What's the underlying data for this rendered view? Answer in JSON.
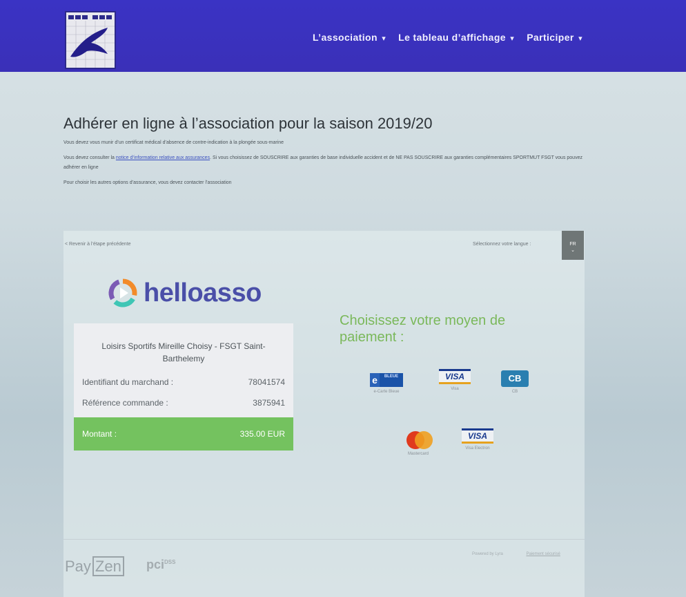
{
  "nav": {
    "items": [
      {
        "label": "L’association"
      },
      {
        "label": "Le tableau d’affichage"
      },
      {
        "label": "Participer"
      }
    ],
    "caret": "▾"
  },
  "page": {
    "title": "Adhérer en ligne à l’association pour la saison 2019/20",
    "info_1": "Vous devez vous munir d’un certificat médical d’absence de contre-indication à la plongée sous-marine",
    "info_2_prefix": "Vous devez consulter la ",
    "info_2_link": "notice d’information relative aux assurances",
    "info_2_suffix": ". Si vous choisissez de SOUSCRIRE aux garanties de base individuelle accident et de NE PAS SOUSCRIRE aux garanties complémentaires SPORTMUT FSGT vous pouvez adhérer en ligne",
    "info_3": "Pour choisir les autres options d’assurance, vous devez contacter l’association"
  },
  "payment": {
    "back_link": "< Revenir à l’étape précédente",
    "lang_label": "Sélectionnez votre langue :",
    "lang_value": "FR",
    "lang_caret": "⌄",
    "brand": "helloasso",
    "org_name": "Loisirs Sportifs Mireille Choisy - FSGT Saint-Barthelemy",
    "merchant_label": "Identifiant du marchand :",
    "merchant_value": "78041574",
    "order_label": "Référence commande :",
    "order_value": "3875941",
    "amount_label": "Montant :",
    "amount_value": "335.00 EUR",
    "choose_title": "Choisissez votre moyen de paiement :",
    "methods": [
      {
        "label": "e-Carte Bleue",
        "icon": "e-carte-bleue-icon"
      },
      {
        "label": "Visa",
        "icon": "visa-icon"
      },
      {
        "label": "CB",
        "icon": "cb-icon"
      },
      {
        "label": "Mastercard",
        "icon": "mastercard-icon"
      },
      {
        "label": "Visa Electron",
        "icon": "visa-electron-icon"
      }
    ],
    "cb_e": "e",
    "cb_bleue": "BLEUE",
    "visa_text": "VISA",
    "cb_text": "CB"
  },
  "footer": {
    "payzen_pay": "Pay",
    "payzen_zen": "Zen",
    "pci": "pci",
    "pci_sub": "DSS",
    "powered": "Powered by Lyra",
    "legal_link": "Paiement sécurisé"
  },
  "colors": {
    "navbar": "#3a33c4",
    "accent_green": "#74c25f",
    "brand_purple": "#4a4fa8"
  }
}
